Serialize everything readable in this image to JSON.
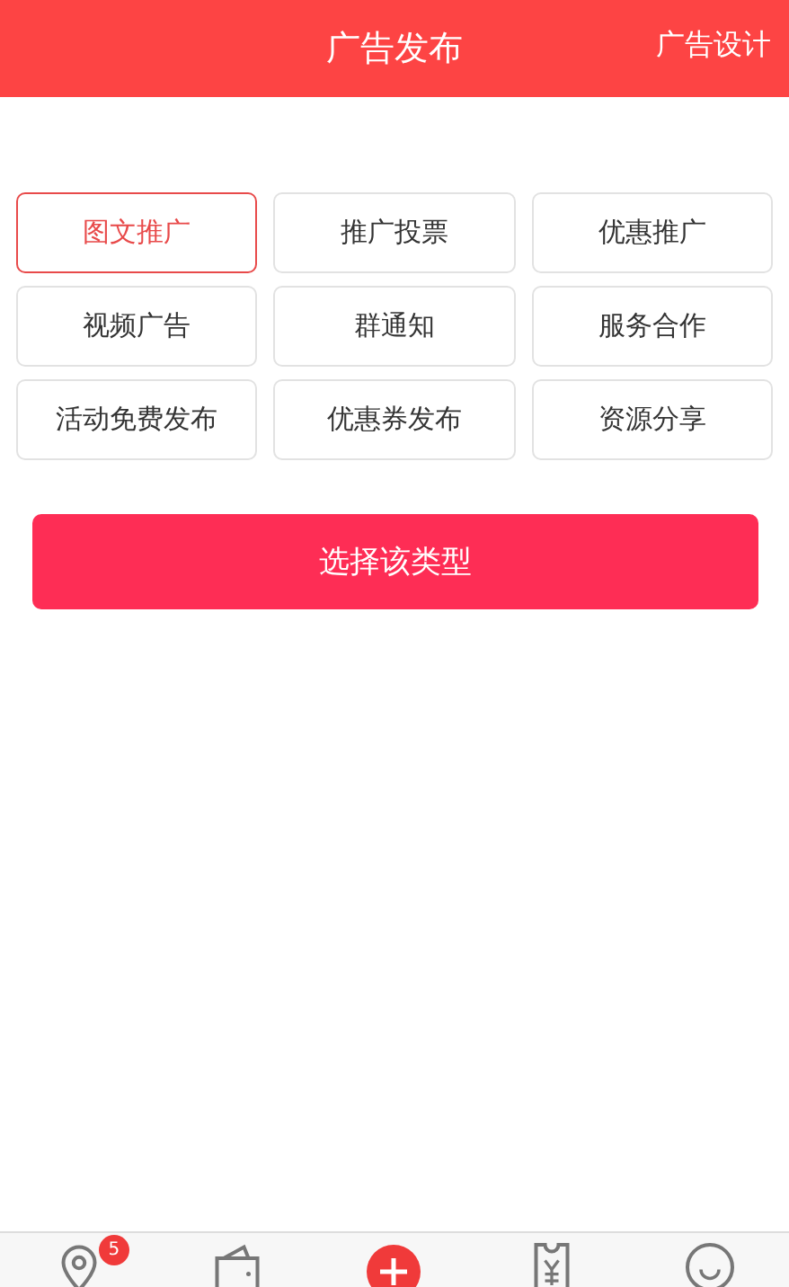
{
  "header": {
    "title": "广告发布",
    "action": "广告设计"
  },
  "types": [
    {
      "label": "图文推广",
      "selected": true
    },
    {
      "label": "推广投票",
      "selected": false
    },
    {
      "label": "优惠推广",
      "selected": false
    },
    {
      "label": "视频广告",
      "selected": false
    },
    {
      "label": "群通知",
      "selected": false
    },
    {
      "label": "服务合作",
      "selected": false
    },
    {
      "label": "活动免费发布",
      "selected": false
    },
    {
      "label": "优惠券发布",
      "selected": false
    },
    {
      "label": "资源分享",
      "selected": false
    }
  ],
  "confirm_button": "选择该类型",
  "nav": [
    {
      "kind": "location",
      "badge": "5"
    },
    {
      "kind": "wallet"
    },
    {
      "kind": "add"
    },
    {
      "kind": "receipt"
    },
    {
      "kind": "smile"
    }
  ]
}
